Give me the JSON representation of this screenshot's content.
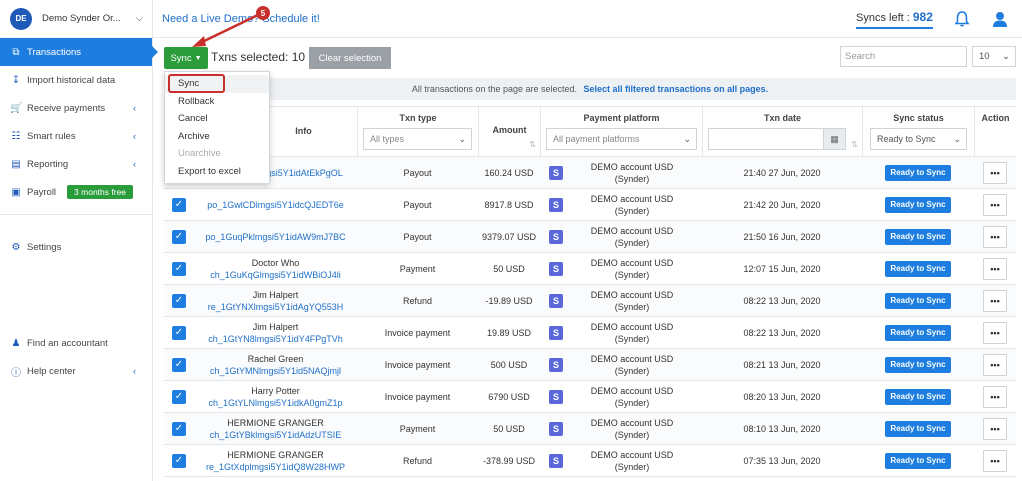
{
  "org": {
    "initials": "DE",
    "name": "Demo Synder Or..."
  },
  "sidebar": {
    "items": [
      {
        "label": "Transactions"
      },
      {
        "label": "Import historical data"
      },
      {
        "label": "Receive payments"
      },
      {
        "label": "Smart rules"
      },
      {
        "label": "Reporting"
      },
      {
        "label": "Payroll",
        "badge": "3 months free"
      },
      {
        "label": "Settings"
      },
      {
        "label": "Find an accountant"
      },
      {
        "label": "Help center"
      }
    ]
  },
  "topbar": {
    "demo_link": "Need a Live Demo? Schedule it!",
    "syncs_left_label": "Syncs left :",
    "syncs_left_value": "982"
  },
  "toolbar": {
    "sync_label": "Sync",
    "txns_selected": "Txns selected: 10",
    "clear_label": "Clear selection",
    "search_placeholder": "Search",
    "per_page": "10"
  },
  "notice": {
    "text": "All transactions on the page are selected.",
    "link": "Select all filtered transactions on all pages."
  },
  "menu": {
    "items": [
      "Sync",
      "Rollback",
      "Cancel",
      "Archive",
      "Unarchive",
      "Export to excel"
    ]
  },
  "annotation": {
    "step": "5"
  },
  "table": {
    "headers": {
      "info": "Info",
      "txn_type": "Txn type",
      "txn_type_filter": "All types",
      "amount": "Amount",
      "platform": "Payment platform",
      "platform_filter": "All payment platforms",
      "date": "Txn date",
      "status": "Sync status",
      "status_filter": "Ready to Sync",
      "action": "Action"
    },
    "rows": [
      {
        "name": "",
        "id": "po_1GwlCDlmgsi5Y1idAtEkPgOL",
        "type": "Payout",
        "amount": "160.24 USD",
        "platform": "DEMO account USD (Synder)",
        "date": "21:40 27 Jun, 2020",
        "status": "Ready to Sync"
      },
      {
        "name": "",
        "id": "po_1GwlCDlmgsi5Y1idcQJEDT6e",
        "type": "Payout",
        "amount": "8917.8 USD",
        "platform": "DEMO account USD (Synder)",
        "date": "21:42 20 Jun, 2020",
        "status": "Ready to Sync"
      },
      {
        "name": "",
        "id": "po_1GuqPklmgsi5Y1idAW9mJ7BC",
        "type": "Payout",
        "amount": "9379.07 USD",
        "platform": "DEMO account USD (Synder)",
        "date": "21:50 16 Jun, 2020",
        "status": "Ready to Sync"
      },
      {
        "name": "Doctor Who",
        "id": "ch_1GuKqGlmgsi5Y1idWBiOJ4li",
        "type": "Payment",
        "amount": "50 USD",
        "platform": "DEMO account USD (Synder)",
        "date": "12:07 15 Jun, 2020",
        "status": "Ready to Sync"
      },
      {
        "name": "Jim Halpert",
        "id": "re_1GtYNXlmgsi5Y1idAgYQ553H",
        "type": "Refund",
        "amount": "-19.89 USD",
        "platform": "DEMO account USD (Synder)",
        "date": "08:22 13 Jun, 2020",
        "status": "Ready to Sync"
      },
      {
        "name": "Jim Halpert",
        "id": "ch_1GtYN8lmgsi5Y1idY4FPgTVh",
        "type": "Invoice payment",
        "amount": "19.89 USD",
        "platform": "DEMO account USD (Synder)",
        "date": "08:22 13 Jun, 2020",
        "status": "Ready to Sync"
      },
      {
        "name": "Rachel Green",
        "id": "ch_1GtYMNlmgsi5Y1id5NAQjmjl",
        "type": "Invoice payment",
        "amount": "500 USD",
        "platform": "DEMO account USD (Synder)",
        "date": "08:21 13 Jun, 2020",
        "status": "Ready to Sync"
      },
      {
        "name": "Harry Potter",
        "id": "ch_1GtYLNlmgsi5Y1idkA0gmZ1p",
        "type": "Invoice payment",
        "amount": "6790 USD",
        "platform": "DEMO account USD (Synder)",
        "date": "08:20 13 Jun, 2020",
        "status": "Ready to Sync"
      },
      {
        "name": "HERMIONE GRANGER",
        "id": "ch_1GtYBklmgsi5Y1idAdzUTSIE",
        "type": "Payment",
        "amount": "50 USD",
        "platform": "DEMO account USD (Synder)",
        "date": "08:10 13 Jun, 2020",
        "status": "Ready to Sync"
      },
      {
        "name": "HERMIONE GRANGER",
        "id": "re_1GtXdplmgsi5Y1idQ8W28HWP",
        "type": "Refund",
        "amount": "-378.99 USD",
        "platform": "DEMO account USD (Synder)",
        "date": "07:35 13 Jun, 2020",
        "status": "Ready to Sync"
      }
    ]
  }
}
